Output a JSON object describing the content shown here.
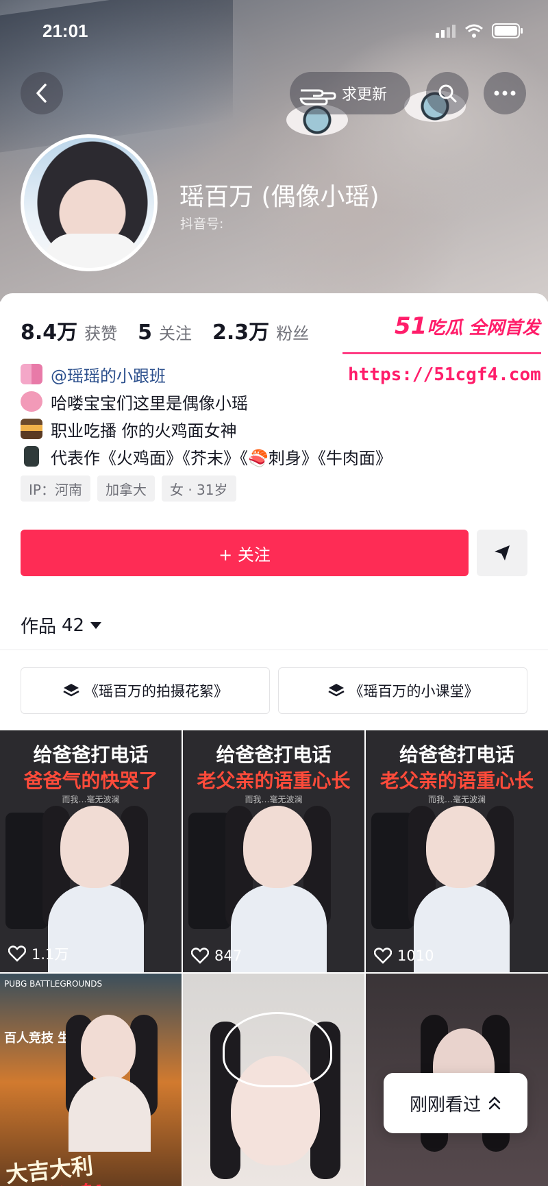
{
  "status_bar": {
    "time": "21:01"
  },
  "header": {
    "update_label": "求更新",
    "nickname": "瑶百万 (偶像小瑶)",
    "douyin_id_label": "抖音号:"
  },
  "stats": [
    {
      "value": "8.4万",
      "label": "获赞"
    },
    {
      "value": "5",
      "label": "关注"
    },
    {
      "value": "2.3万",
      "label": "粉丝"
    }
  ],
  "watermark": {
    "brand_num": "51",
    "brand_text": "吃瓜 全网首发",
    "url": "https://51cgf4.com"
  },
  "bio": {
    "link": "@瑶瑶的小跟班",
    "lines": [
      "哈喽宝宝们这里是偶像小瑶",
      "职业吃播 你的火鸡面女神",
      "代表作《火鸡面》《芥末》《🍣刺身》《牛肉面》"
    ]
  },
  "tags": [
    "IP：河南",
    "加拿大",
    "女 · 31岁"
  ],
  "follow_label": "+ 关注",
  "works": {
    "label": "作品",
    "count": "42"
  },
  "collections": [
    "《瑶百万的拍摄花絮》",
    "《瑶百万的小课堂》"
  ],
  "videos": [
    {
      "title1": "给爸爸打电话",
      "title2": "爸爸气的快哭了",
      "sub": "而我…毫无波澜",
      "likes": "1.1万"
    },
    {
      "title1": "给爸爸打电话",
      "title2": "老父亲的语重心长",
      "sub": "而我…毫无波澜",
      "likes": "847"
    },
    {
      "title1": "给爸爸打电话",
      "title2": "老父亲的语重心长",
      "sub": "而我…毫无波澜",
      "likes": "1010"
    },
    {
      "logo": "PUBG BATTLEGROUNDS",
      "badge": "百人竞技 生存为王",
      "big": "大吉大利",
      "red": "今晚吃鸡!"
    }
  ],
  "recent_label": "刚刚看过",
  "colors": {
    "accent": "#fe2c55",
    "watermark": "#ff1d6a",
    "link": "#2b4f8c"
  }
}
